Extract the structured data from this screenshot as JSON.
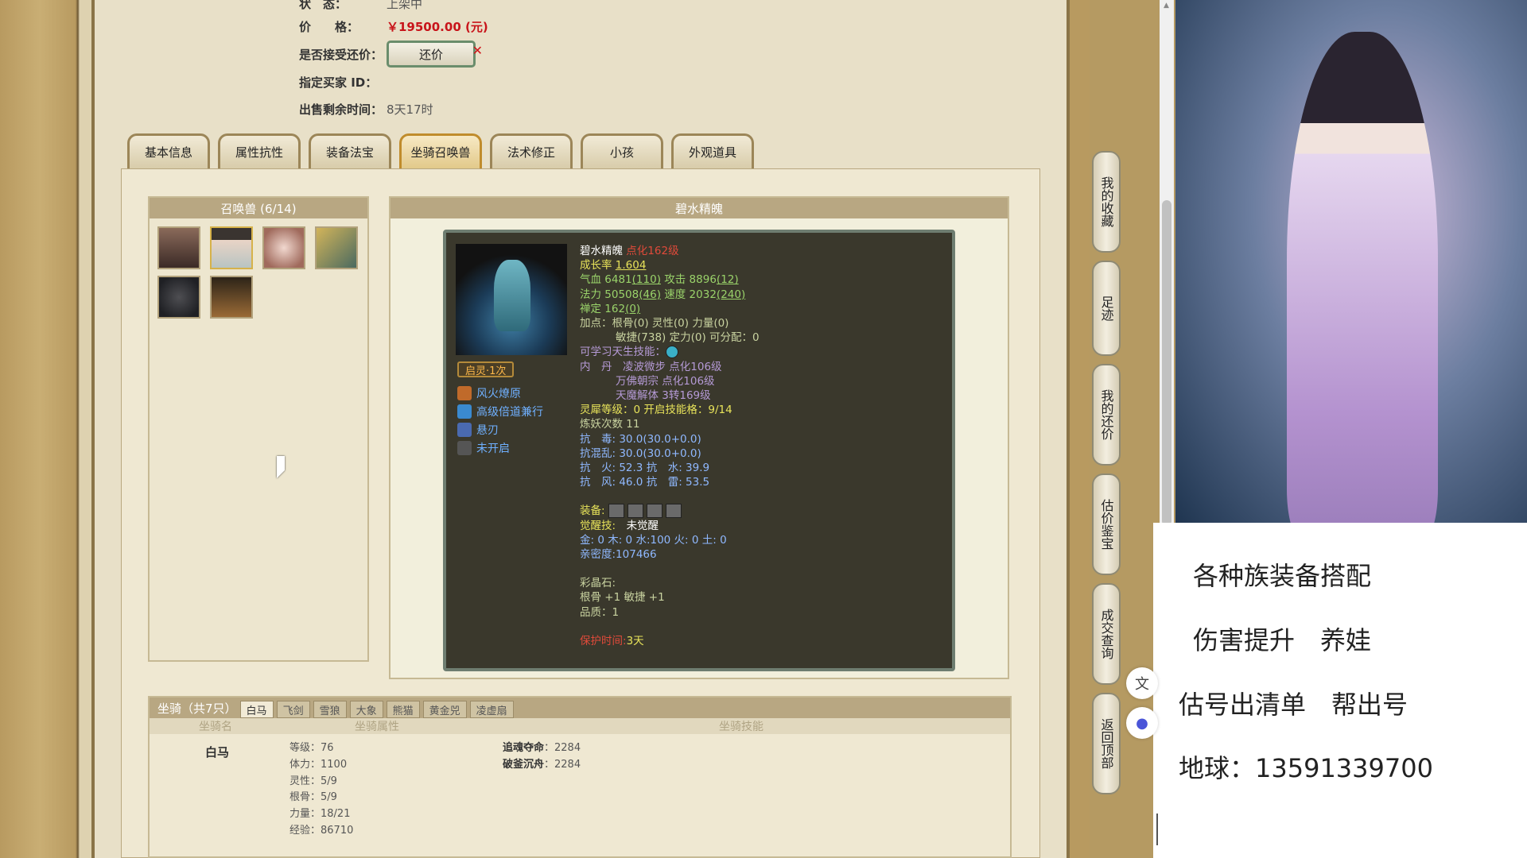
{
  "info": {
    "status_label": "状　态：",
    "status_value": "上架中",
    "price_label": "价　　格：",
    "price_value": "￥19500.00 (元)",
    "bargain_label": "是否接受还价：",
    "bargain_button": "还价",
    "bargain_x": "✕",
    "buyer_label": "指定买家 ID：",
    "remaining_label": "出售剩余时间：",
    "remaining_value": "8天17时"
  },
  "tabs": [
    "基本信息",
    "属性抗性",
    "装备法宝",
    "坐骑召唤兽",
    "法术修正",
    "小孩",
    "外观道具"
  ],
  "pets_panel": {
    "title": "召唤兽 (6/14)"
  },
  "detail": {
    "title": "碧水精魄",
    "awaken_tag": "启灵·1次",
    "skills": [
      "风火燎原",
      "高级倍道兼行",
      "悬刃",
      "未开启"
    ],
    "name": "碧水精魄",
    "name_suffix": "点化162级",
    "growth_label": "成长率",
    "growth_value": "1.604",
    "line_hp": "气血 6481",
    "line_hp_paren": "(110)",
    "line_atk": "攻击 8896",
    "line_atk_paren": "(12)",
    "line_mp": "法力 50508",
    "line_mp_paren": "(46)",
    "line_spd": "速度 2032",
    "line_spd_paren": "(240)",
    "line_zen": "禅定 162",
    "line_zen_paren": "(0)",
    "points1": "加点：根骨(0) 灵性(0) 力量(0)",
    "points2": "敏捷(738) 定力(0) 可分配：0",
    "learnable": "可学习天生技能：",
    "neidan_label": "内　丹",
    "neidan1": "凌波微步 点化106级",
    "neidan2": "万佛朝宗 点化106级",
    "neidan3": "天魔解体 3转169级",
    "lingxi": "灵犀等级：0 开启技能格：9/14",
    "lianyao": "炼妖次数 11",
    "res1": "抗　毒: 30.0(30.0+0.0)",
    "res2": "抗混乱: 30.0(30.0+0.0)",
    "res3": "抗　火: 52.3 抗　水: 39.9",
    "res4": "抗　风: 46.0 抗　雷: 53.5",
    "equip_label": "装备:",
    "juexing_label": "觉醒技:",
    "juexing_value": "未觉醒",
    "elements": "金: 0 木: 0 水:100 火: 0 土: 0",
    "intimacy": "亲密度:107466",
    "crystal_label": "彩晶石:",
    "crystal_value": "根骨 +1 敏捷 +1",
    "quality": "品质：1",
    "protect_label": "保护时间:",
    "protect_value": "3天"
  },
  "mount": {
    "title": "坐骑（共7只）",
    "tabs": [
      "白马",
      "飞剑",
      "雪狼",
      "大象",
      "熊猫",
      "黄金兕",
      "凌虚扇"
    ],
    "col_name": "坐骑名",
    "col_attr": "坐骑属性",
    "col_skill": "坐骑技能",
    "name": "白马",
    "attrs": [
      "等级：76",
      "体力：1100",
      "灵性：5/9",
      "根骨：5/9",
      "力量：18/21",
      "经验：86710"
    ],
    "skill1_name": "追魂夺命",
    "skill1_val": "：2284",
    "skill2_name": "破釜沉舟",
    "skill2_val": "：2284"
  },
  "sidenav": [
    "我的收藏",
    "足迹",
    "我的还价",
    "估价鉴宝",
    "成交查询",
    "返回顶部"
  ],
  "promo": {
    "line1": "各种族装备搭配",
    "line2": "伤害提升　养娃",
    "line3": "估号出清单　帮出号",
    "line4": "地球：13591339700"
  },
  "colors": {
    "price": "#c8141a",
    "tab_active": "#e2c98a",
    "panel_head": "#b8a782"
  }
}
